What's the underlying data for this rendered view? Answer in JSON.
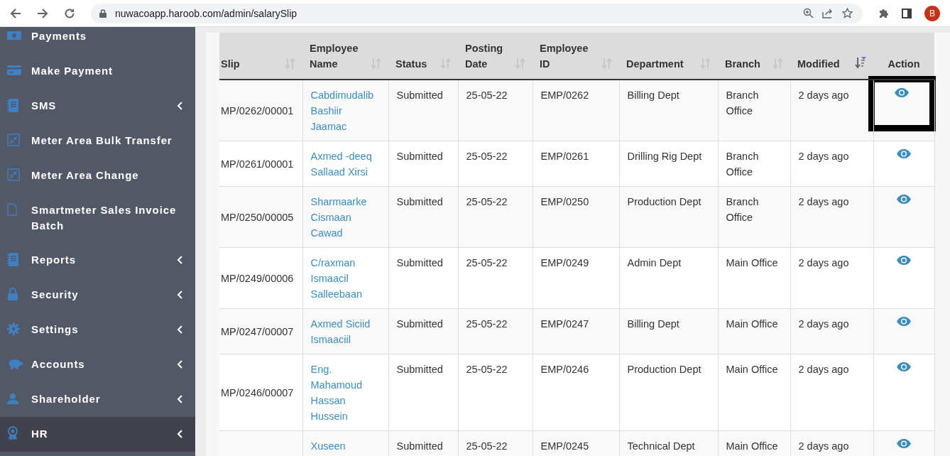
{
  "browser": {
    "url": "nuwacoapp.haroob.com/admin/salarySlip",
    "profile_letter": "B"
  },
  "sidebar": {
    "items": [
      {
        "label": "Payments",
        "kind": "cash",
        "submenu": false,
        "selected": false
      },
      {
        "label": "Make Payment",
        "kind": "card",
        "submenu": false,
        "selected": false
      },
      {
        "label": "SMS",
        "kind": "book",
        "submenu": true,
        "selected": false
      },
      {
        "label": "Meter Area Bulk Transfer",
        "kind": "shrink",
        "submenu": false,
        "selected": false
      },
      {
        "label": "Meter Area Change",
        "kind": "shrink",
        "submenu": false,
        "selected": false
      },
      {
        "label": "Smartmeter Sales Invoice Batch",
        "kind": "file",
        "submenu": false,
        "selected": false
      },
      {
        "label": "Reports",
        "kind": "book",
        "submenu": true,
        "selected": false
      },
      {
        "label": "Security",
        "kind": "lock",
        "submenu": true,
        "selected": false
      },
      {
        "label": "Settings",
        "kind": "gear",
        "submenu": true,
        "selected": false
      },
      {
        "label": "Accounts",
        "kind": "piggy",
        "submenu": true,
        "selected": false
      },
      {
        "label": "Shareholder",
        "kind": "user",
        "submenu": true,
        "selected": false
      },
      {
        "label": "HR",
        "kind": "award",
        "submenu": true,
        "selected": true
      }
    ]
  },
  "table": {
    "columns": [
      {
        "label": "Slip",
        "sorted": false
      },
      {
        "label": "Employee Name",
        "sorted": false
      },
      {
        "label": "Status",
        "sorted": false
      },
      {
        "label": "Posting Date",
        "sorted": false
      },
      {
        "label": "Employee ID",
        "sorted": false
      },
      {
        "label": "Department",
        "sorted": false
      },
      {
        "label": "Branch",
        "sorted": false
      },
      {
        "label": "Modified",
        "sorted": true
      },
      {
        "label": "Action"
      }
    ],
    "rows": [
      {
        "slip": "MP/0262/00001",
        "name": "Cabdimudalib Bashiir Jaamac",
        "status": "Submitted",
        "date": "25-05-22",
        "id": "EMP/0262",
        "department": "Billing Dept",
        "branch": "Branch Office",
        "modified": "2 days ago",
        "highlighted": true
      },
      {
        "slip": "MP/0261/00001",
        "name": "Axmed -deeq Sallaad Xirsi",
        "status": "Submitted",
        "date": "25-05-22",
        "id": "EMP/0261",
        "department": "Drilling Rig Dept",
        "branch": "Branch Office",
        "modified": "2 days ago",
        "highlighted": false
      },
      {
        "slip": "MP/0250/00005",
        "name": "Sharmaarke Cismaan Cawad",
        "status": "Submitted",
        "date": "25-05-22",
        "id": "EMP/0250",
        "department": "Production Dept",
        "branch": "Branch Office",
        "modified": "2 days ago",
        "highlighted": false
      },
      {
        "slip": "MP/0249/00006",
        "name": "C/raxman Ismaacil Salleebaan",
        "status": "Submitted",
        "date": "25-05-22",
        "id": "EMP/0249",
        "department": "Admin Dept",
        "branch": "Main Office",
        "modified": "2 days ago",
        "highlighted": false
      },
      {
        "slip": "MP/0247/00007",
        "name": "Axmed Siciid Ismaaciil",
        "status": "Submitted",
        "date": "25-05-22",
        "id": "EMP/0247",
        "department": "Billing Dept",
        "branch": "Main Office",
        "modified": "2 days ago",
        "highlighted": false
      },
      {
        "slip": "MP/0246/00007",
        "name": "Eng. Mahamoud Hassan Hussein",
        "status": "Submitted",
        "date": "25-05-22",
        "id": "EMP/0246",
        "department": "Production Dept",
        "branch": "Main Office",
        "modified": "2 days ago",
        "highlighted": false
      },
      {
        "name": "Xuseen",
        "status": "Submitted",
        "date": "25-05-22",
        "id": "EMP/0245",
        "department": "Technical Dept",
        "branch": "Main Office",
        "modified": "2 days ago",
        "highlighted": false
      }
    ]
  }
}
